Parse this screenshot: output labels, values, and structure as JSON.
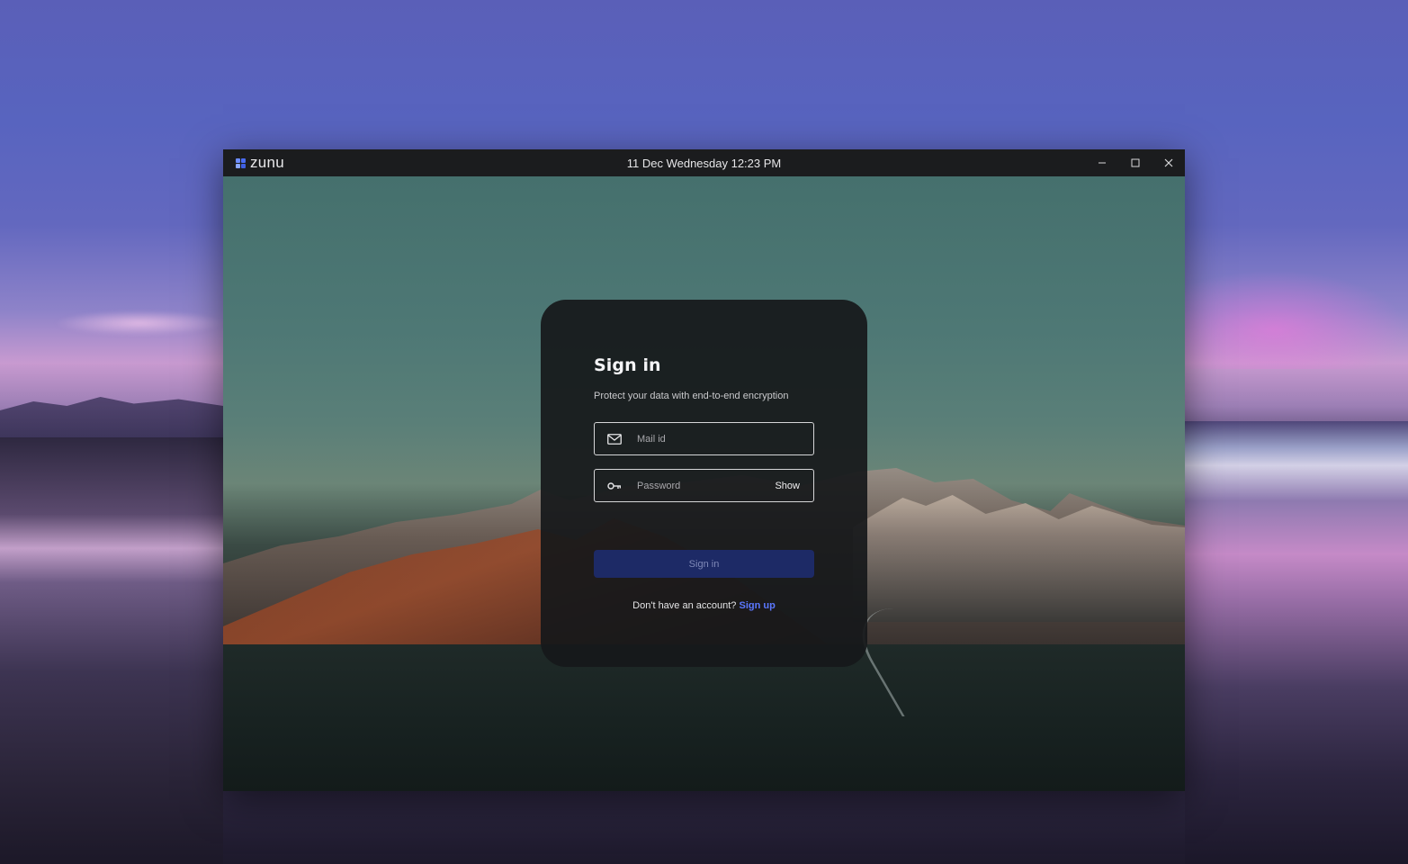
{
  "app": {
    "name": "zunu",
    "logo_colors": [
      "#6c8cff",
      "#4a6cf0",
      "#8aa6ff",
      "#3f5fe0"
    ]
  },
  "titlebar": {
    "datetime": "11 Dec Wednesday 12:23 PM",
    "controls": {
      "minimize_icon": "minimize-icon",
      "maximize_icon": "maximize-icon",
      "close_icon": "close-icon"
    }
  },
  "signin": {
    "title": "Sign in",
    "subtitle": "Protect your data with end-to-end encryption",
    "email": {
      "placeholder": "Mail id",
      "value": "",
      "icon": "mail-icon"
    },
    "password": {
      "placeholder": "Password",
      "value": "",
      "icon": "key-icon",
      "toggle_label": "Show"
    },
    "button_label": "Sign in",
    "no_account_text": "Don't have an account?",
    "signup_label": "Sign up"
  },
  "colors": {
    "accent": "#5b78ff",
    "button_bg": "#1d2a66",
    "card_bg": "#16181a"
  }
}
